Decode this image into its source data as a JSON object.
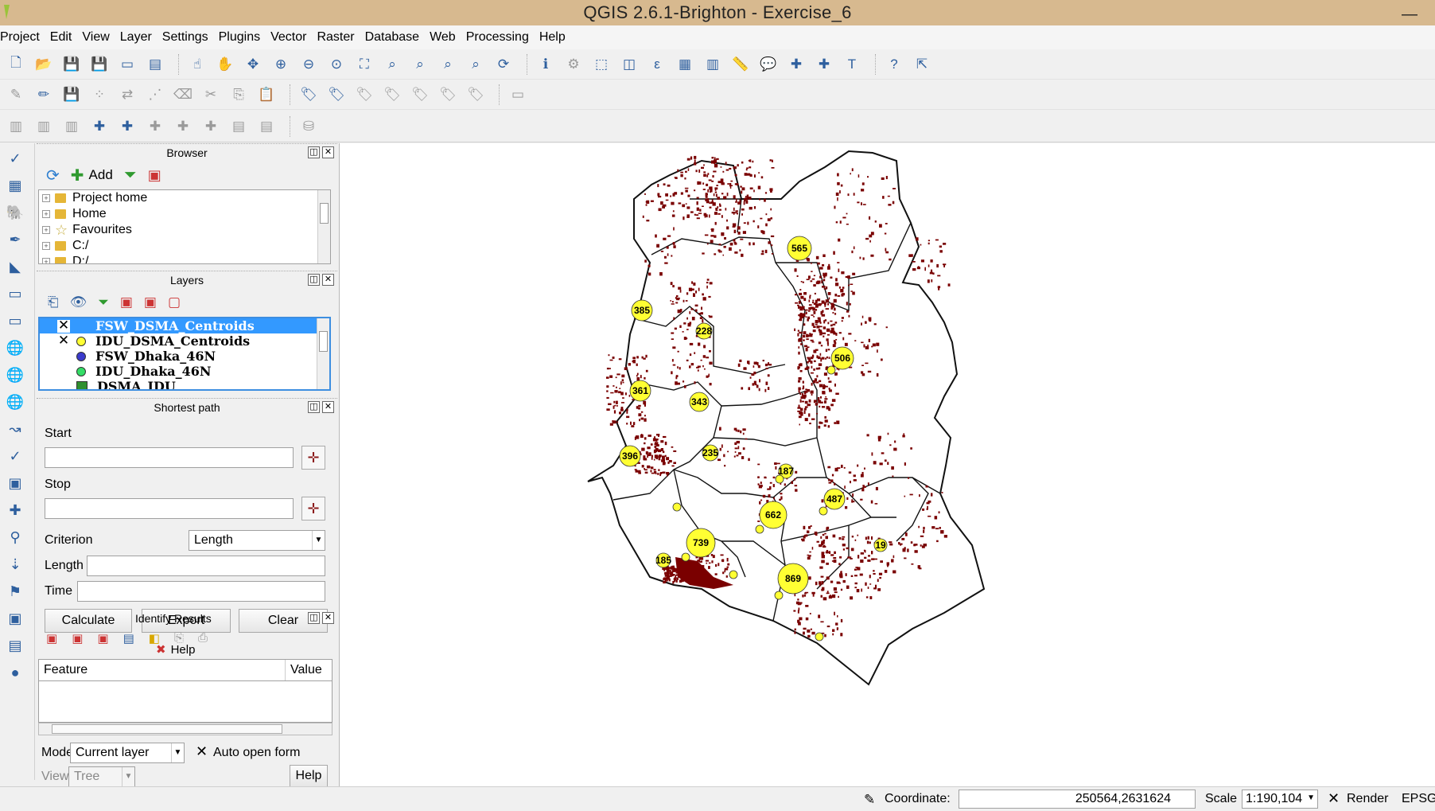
{
  "window": {
    "title": "QGIS 2.6.1-Brighton - Exercise_6",
    "minimize_glyph": "—"
  },
  "menu": [
    "Project",
    "Edit",
    "View",
    "Layer",
    "Settings",
    "Plugins",
    "Vector",
    "Raster",
    "Database",
    "Web",
    "Processing",
    "Help"
  ],
  "browser": {
    "title": "Browser",
    "add_label": "Add",
    "items": [
      "Project home",
      "Home",
      "Favourites",
      "C:/",
      "D:/"
    ]
  },
  "layers": {
    "title": "Layers",
    "items": [
      {
        "name": "FSW_DSMA_Centroids",
        "checked": "✕",
        "color": "#ffff33"
      },
      {
        "name": "IDU_DSMA_Centroids",
        "checked": "✕",
        "color": "#ffff33"
      },
      {
        "name": "FSW_Dhaka_46N",
        "checked": "",
        "color": "#3b3bcc"
      },
      {
        "name": "IDU_Dhaka_46N",
        "checked": "",
        "color": "#33dd66"
      },
      {
        "name": "DSMA_IDU",
        "checked": "",
        "color": "#2f8f2f"
      }
    ]
  },
  "shortest_path": {
    "title": "Shortest path",
    "start_label": "Start",
    "stop_label": "Stop",
    "criterion_label": "Criterion",
    "criterion_value": "Length",
    "length_label": "Length",
    "time_label": "Time",
    "calculate_label": "Calculate",
    "export_label": "Export",
    "clear_label": "Clear",
    "help_label": "Help"
  },
  "identify": {
    "title": "Identify Results",
    "col_feature": "Feature",
    "col_value": "Value",
    "mode_label": "Mode",
    "mode_value": "Current layer",
    "auto_open_label": "Auto open form",
    "view_label": "View",
    "view_value": "Tree",
    "help_label": "Help"
  },
  "map": {
    "district_fill": "#ffffff",
    "district_stroke": "#111111",
    "point_color": "#7a0000",
    "centroid_color": "#ffff33",
    "labels": [
      {
        "text": "565"
      },
      {
        "text": "385"
      },
      {
        "text": "228"
      },
      {
        "text": "506"
      },
      {
        "text": "361"
      },
      {
        "text": "343"
      },
      {
        "text": "396"
      },
      {
        "text": "235"
      },
      {
        "text": "187"
      },
      {
        "text": "487"
      },
      {
        "text": "662"
      },
      {
        "text": "739"
      },
      {
        "text": "19"
      },
      {
        "text": "185"
      },
      {
        "text": "869"
      }
    ]
  },
  "status": {
    "coordinate_label": "Coordinate:",
    "coordinate_value": "250564,2631624",
    "scale_label": "Scale",
    "scale_value": "1:190,104",
    "render_label": "Render",
    "epsg_label": "EPSG"
  }
}
